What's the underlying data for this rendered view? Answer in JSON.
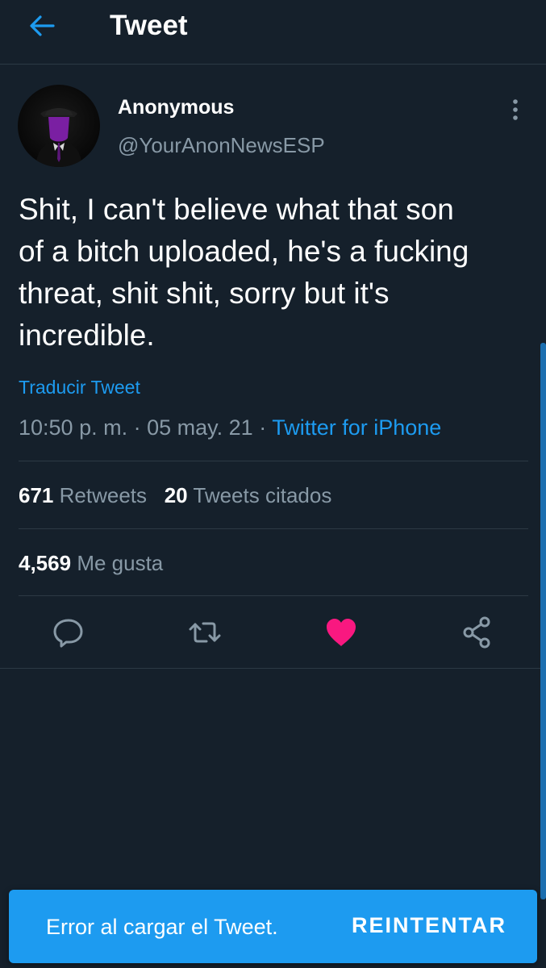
{
  "header": {
    "title": "Tweet",
    "back_icon": "arrow-left-icon",
    "accent_color": "#1d9bf0"
  },
  "author": {
    "name": "Anonymous",
    "handle": "@YourAnonNewsESP",
    "avatar_icon": "hooded-figure-avatar"
  },
  "tweet": {
    "lines": [
      "Shit, I can't believe what that son",
      "of a bitch uploaded, he's a fucking",
      "threat, shit shit, sorry but it's",
      "incredible."
    ],
    "translate_label": "Traducir Tweet",
    "time": "10:50 p. m.",
    "separator": "·",
    "date": "05 may. 21",
    "source": "Twitter for iPhone"
  },
  "stats": {
    "retweets_count": "671",
    "retweets_label": "Retweets",
    "quotes_count": "20",
    "quotes_label": "Tweets citados",
    "likes_count": "4,569",
    "likes_label": "Me gusta"
  },
  "actions": {
    "reply_icon": "reply-icon",
    "retweet_icon": "retweet-icon",
    "like_icon": "heart-icon",
    "like_color": "#f91880",
    "liked": true,
    "share_icon": "share-icon"
  },
  "toast": {
    "message": "Error al cargar el Tweet.",
    "action_label": "REINTENTAR",
    "background": "#1d9bf0"
  }
}
